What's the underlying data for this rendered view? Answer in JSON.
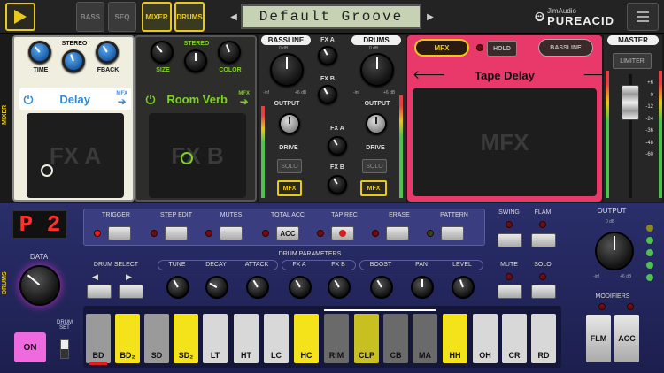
{
  "topbar": {
    "tabs": [
      "BASS",
      "SEQ",
      "MIXER",
      "DRUMS"
    ],
    "pattern_name": "Default Groove",
    "logo_top": "JimAudio",
    "logo_bottom": "PUREACID"
  },
  "side_labels": {
    "mixer": "MIXER",
    "drums": "DRUMS"
  },
  "fx_a": {
    "knob_labels": [
      "TIME",
      "STEREO",
      "FBACK"
    ],
    "name": "Delay",
    "badge": "MFX",
    "pad_label": "FX A"
  },
  "fx_b": {
    "knob_labels": [
      "SIZE",
      "STEREO",
      "COLOR"
    ],
    "name": "Room Verb",
    "badge": "MFX",
    "pad_label": "FX B"
  },
  "bassline_ch": {
    "title": "BASSLINE",
    "scale_top": "0 dB",
    "scale_left": "-inf",
    "scale_right": "+6 dB",
    "output": "OUTPUT",
    "drive": "DRIVE",
    "solo": "SOLO",
    "mfx": "MFX",
    "fxa": "FX A",
    "fxb": "FX B"
  },
  "drums_ch": {
    "title": "DRUMS",
    "scale_top": "0 dB",
    "scale_left": "-inf",
    "scale_right": "+6 dB",
    "output": "OUTPUT",
    "drive": "DRIVE",
    "solo": "SOLO",
    "mfx": "MFX",
    "fxa": "FX A",
    "fxb": "FX B"
  },
  "mfx": {
    "btn_mfx": "MFX",
    "btn_hold": "HOLD",
    "btn_bassline": "BASSLINE",
    "effect": "Tape Delay",
    "pad_label": "MFX"
  },
  "master": {
    "title": "MASTER",
    "limiter": "LIMITER",
    "scale": [
      "+6",
      "0",
      "-12",
      "-24",
      "-36",
      "-48",
      "-60"
    ]
  },
  "drums": {
    "pattern_display": "P 2",
    "data": "DATA",
    "on": "ON",
    "drum_set": "DRUM SET",
    "drum_select": "DRUM  SELECT",
    "modes": [
      "TRIGGER",
      "STEP EDIT",
      "MUTES",
      "TOTAL ACC",
      "TAP REC",
      "ERASE",
      "PATTERN"
    ],
    "acc": "ACC",
    "params_title": "DRUM PARAMETERS",
    "params": [
      "TUNE",
      "DECAY",
      "ATTACK",
      "FX A",
      "FX B",
      "BOOST",
      "PAN",
      "LEVEL"
    ],
    "swing": "SWING",
    "flam": "FLAM",
    "mute": "MUTE",
    "solo": "SOLO",
    "output": "OUTPUT",
    "out_top": "0 dB",
    "out_left": "-inf",
    "out_right": "+6 dB",
    "modifiers": "MODIFIERS",
    "flm": "FLM",
    "acc_mod": "ACC",
    "pads": [
      "BD",
      "BD₂",
      "SD",
      "SD₂",
      "LT",
      "HT",
      "LC",
      "HC",
      "RIM",
      "CLP",
      "CB",
      "MA",
      "HH",
      "OH",
      "CR",
      "RD"
    ]
  },
  "colors": {
    "accent": "#e8c81a",
    "mfx": "#e8396a",
    "drum_bg": "#1c1f4e",
    "green": "#7ed321",
    "blue": "#2a8be0"
  }
}
